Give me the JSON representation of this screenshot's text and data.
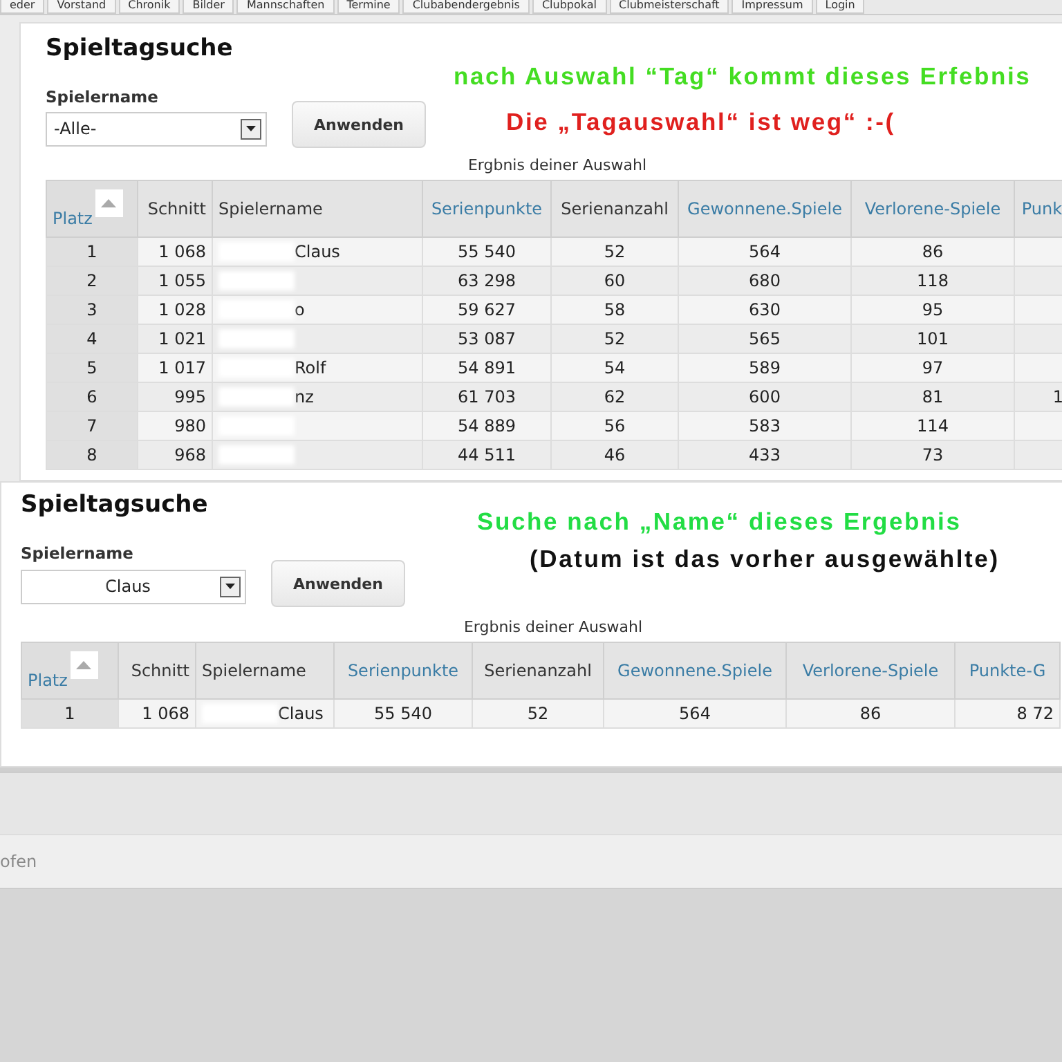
{
  "nav_tabs": [
    "eder",
    "Vorstand",
    "Chronik",
    "Bilder",
    "Mannschaften",
    "Termine",
    "Clubabendergebnis",
    "Clubpokal",
    "Clubmeisterschaft",
    "Impressum",
    "Login"
  ],
  "panels": [
    {
      "title": "Spieltagsuche",
      "annotations": [
        {
          "text": "nach Auswahl “Tag“ kommt dieses Erfebnis",
          "color": "#44dd22"
        },
        {
          "text": "Die „Tagauswahl“ ist weg“ :-(",
          "color": "#e0201e"
        }
      ],
      "filter_label": "Spielername",
      "filter_value": "-Alle-",
      "filter_blurred": false,
      "apply_button": "Anwenden",
      "caption": "Ergbnis deiner Auswahl",
      "columns": [
        {
          "label": "Platz",
          "sortable": true,
          "sorted": true
        },
        {
          "label": "Schnitt",
          "sortable": false,
          "sorted": false
        },
        {
          "label": "Spielername",
          "sortable": false,
          "sorted": false
        },
        {
          "label": "Serienpunkte",
          "sortable": true,
          "sorted": false
        },
        {
          "label": "Serienanzahl",
          "sortable": false,
          "sorted": false
        },
        {
          "label": "Gewonnene.Spiele",
          "sortable": true,
          "sorted": false
        },
        {
          "label": "Verlorene-Spiele",
          "sortable": true,
          "sorted": false
        },
        {
          "label": "Punk",
          "sortable": true,
          "sorted": false
        }
      ],
      "rows": [
        {
          "platz": "1",
          "schnitt": "1 068",
          "name": "Claus",
          "blurred": true,
          "serienpunkte": "55 540",
          "serienanzahl": "52",
          "gewonnen": "564",
          "verloren": "86"
        },
        {
          "platz": "2",
          "schnitt": "1 055",
          "name": "",
          "blurred": true,
          "serienpunkte": "63 298",
          "serienanzahl": "60",
          "gewonnen": "680",
          "verloren": "118"
        },
        {
          "platz": "3",
          "schnitt": "1 028",
          "name": "o",
          "blurred": true,
          "serienpunkte": "59 627",
          "serienanzahl": "58",
          "gewonnen": "630",
          "verloren": "95"
        },
        {
          "platz": "4",
          "schnitt": "1 021",
          "name": "",
          "blurred": true,
          "serienpunkte": "53 087",
          "serienanzahl": "52",
          "gewonnen": "565",
          "verloren": "101"
        },
        {
          "platz": "5",
          "schnitt": "1 017",
          "name": "Rolf",
          "blurred": true,
          "serienpunkte": "54 891",
          "serienanzahl": "54",
          "gewonnen": "589",
          "verloren": "97"
        },
        {
          "platz": "6",
          "schnitt": "995",
          "name": "nz",
          "blurred": true,
          "serienpunkte": "61 703",
          "serienanzahl": "62",
          "gewonnen": "600",
          "verloren": "81",
          "extra": "1"
        },
        {
          "platz": "7",
          "schnitt": "980",
          "name": "",
          "blurred": true,
          "serienpunkte": "54 889",
          "serienanzahl": "56",
          "gewonnen": "583",
          "verloren": "114"
        },
        {
          "platz": "8",
          "schnitt": "968",
          "name": "",
          "blurred": true,
          "serienpunkte": "44 511",
          "serienanzahl": "46",
          "gewonnen": "433",
          "verloren": "73"
        }
      ]
    },
    {
      "title": "Spieltagsuche",
      "annotations": [
        {
          "text": "Suche nach „Name“ dieses Ergebnis",
          "color": "#22dd44"
        },
        {
          "text": "(Datum ist das vorher ausgewählte)",
          "color": "#111111"
        }
      ],
      "filter_label": "Spielername",
      "filter_value": "Claus",
      "filter_blurred": true,
      "apply_button": "Anwenden",
      "caption": "Ergbnis deiner Auswahl",
      "columns": [
        {
          "label": "Platz",
          "sortable": true,
          "sorted": true
        },
        {
          "label": "Schnitt",
          "sortable": false,
          "sorted": false
        },
        {
          "label": "Spielername",
          "sortable": false,
          "sorted": false
        },
        {
          "label": "Serienpunkte",
          "sortable": true,
          "sorted": false
        },
        {
          "label": "Serienanzahl",
          "sortable": false,
          "sorted": false
        },
        {
          "label": "Gewonnene.Spiele",
          "sortable": true,
          "sorted": false
        },
        {
          "label": "Verlorene-Spiele",
          "sortable": true,
          "sorted": false
        },
        {
          "label": "Punkte-G",
          "sortable": true,
          "sorted": false
        }
      ],
      "rows": [
        {
          "platz": "1",
          "schnitt": "1 068",
          "name": "Claus",
          "blurred": true,
          "serienpunkte": "55 540",
          "serienanzahl": "52",
          "gewonnen": "564",
          "verloren": "86",
          "extra": "8 72"
        }
      ]
    }
  ],
  "footer_text": "ofen"
}
